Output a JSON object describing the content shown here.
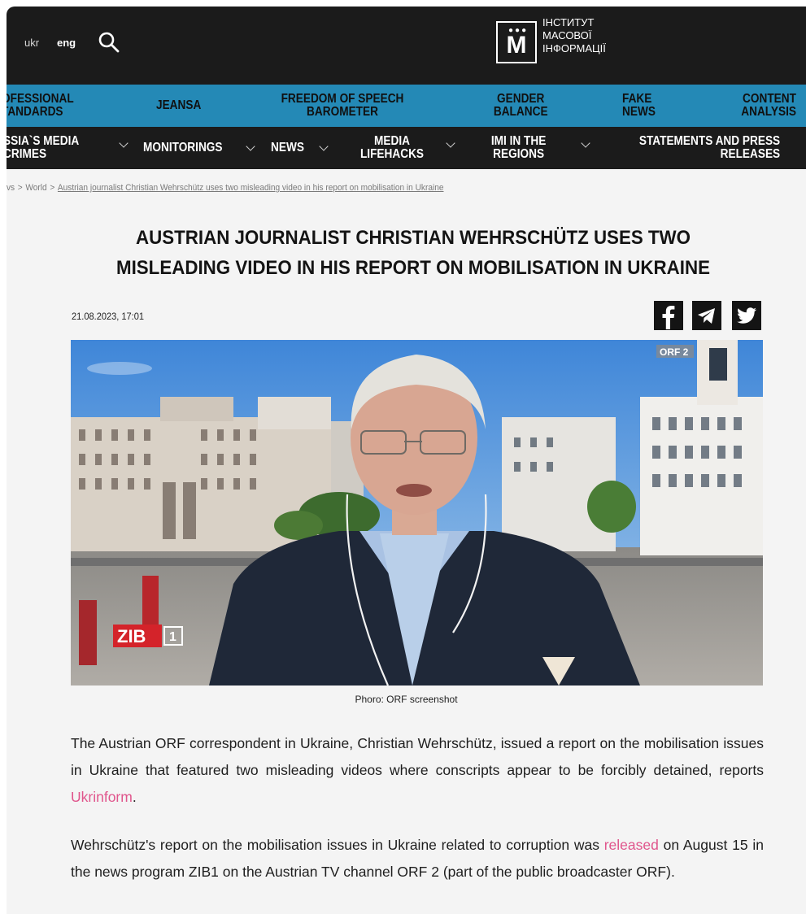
{
  "header": {
    "lang_ukr": "ukr",
    "lang_eng": "eng",
    "logo_lines": [
      "ІНСТИТУТ",
      "МАСОВОЇ",
      "ІНФОРМАЦІЇ"
    ],
    "logo_letter": "М"
  },
  "nav_primary": [
    {
      "line1": "OFESSIONAL",
      "line2": "TANDARDS"
    },
    {
      "line1": "JEANSA",
      "line2": ""
    },
    {
      "line1": "FREEDOM OF SPEECH",
      "line2": "BAROMETER"
    },
    {
      "line1": "GENDER",
      "line2": "BALANCE"
    },
    {
      "line1": "FAKE",
      "line2": "NEWS"
    },
    {
      "line1": "CONTENT",
      "line2": "ANALYSIS"
    }
  ],
  "nav_secondary": [
    {
      "line1": "SSIA`S MEDIA",
      "line2": "CRIMES"
    },
    {
      "line1": "MONITORINGS",
      "line2": ""
    },
    {
      "line1": "NEWS",
      "line2": ""
    },
    {
      "line1": "MEDIA",
      "line2": "LIFEHACKS"
    },
    {
      "line1": "IMI IN THE",
      "line2": "REGIONS"
    },
    {
      "line1": "STATEMENTS AND PRESS",
      "line2": "RELEASES"
    }
  ],
  "breadcrumb": {
    "items": [
      "vs",
      "World",
      "Austrian journalist Christian Wehrschütz uses two misleading video in his report on mobilisation in Ukraine"
    ],
    "separator": ">"
  },
  "article": {
    "title_line1": "AUSTRIAN JOURNALIST CHRISTIAN WEHRSCHÜTZ USES TWO",
    "title_line2": "MISLEADING VIDEO IN HIS REPORT ON MOBILISATION IN UKRAINE",
    "date": "21.08.2023, 17:01",
    "share_icons": [
      "facebook-icon",
      "telegram-icon",
      "twitter-icon"
    ],
    "photo_overlay_channel": "ORF 2",
    "photo_overlay_program": "ZIB",
    "photo_overlay_program_num": "1",
    "caption": "Phoro: ORF screenshot",
    "p1_before": "The Austrian ORF correspondent in Ukraine, Christian Wehrschütz, issued a report on the mobilisation issues in Ukraine that featured two misleading videos where conscripts appear to be forcibly detained, reports ",
    "p1_link": "Ukrinform",
    "p1_after": ".",
    "p2_before": "Wehrschütz's report on the mobilisation issues in Ukraine related to corruption was ",
    "p2_link": "released",
    "p2_after": " on August 15 in the news program ZIB1 on the Austrian TV channel ORF 2 (part of the public broadcaster ORF).",
    "link_color": "#e0558c"
  }
}
